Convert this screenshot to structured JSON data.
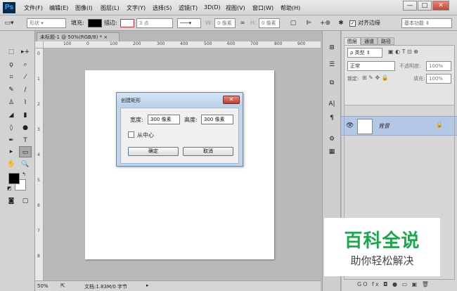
{
  "app": {
    "logo": "Ps"
  },
  "menu": [
    "文件(F)",
    "编辑(E)",
    "图像(I)",
    "图层(L)",
    "文字(Y)",
    "选择(S)",
    "滤镜(T)",
    "3D(D)",
    "视图(V)",
    "窗口(W)",
    "帮助(H)"
  ],
  "window_controls": {
    "minimize": "—",
    "maximize": "□",
    "close": "✕"
  },
  "options": {
    "shape_mode": "形状",
    "fill_label": "填充:",
    "stroke_label": "描边:",
    "stroke_size": "3 点",
    "w_label": "W:",
    "w_value": "0 像素",
    "h_label": "H:",
    "h_value": "0 像素",
    "align_edges_label": "对齐边缘",
    "workspace": "基本功能"
  },
  "document": {
    "tab_title": "未标题-1 @ 50%(RGB/8) *",
    "ruler_top": [
      "100",
      "0",
      "100",
      "200",
      "300",
      "400",
      "500",
      "600",
      "700",
      "800",
      "900"
    ],
    "ruler_left": [
      "0",
      "1",
      "2",
      "3",
      "4",
      "5",
      "6",
      "7",
      "8"
    ]
  },
  "status": {
    "zoom": "50%",
    "doc_info": "文档:1.83M/0 字节"
  },
  "dialog": {
    "title": "创建矩形",
    "width_label": "宽度:",
    "width_value": "300 像素",
    "height_label": "高度:",
    "height_value": "300 像素",
    "from_center_label": "从中心",
    "ok_label": "确定",
    "cancel_label": "取消"
  },
  "layers_panel": {
    "tabs": [
      "图层",
      "通道",
      "路径"
    ],
    "kind_filter": "ρ 类型",
    "blend_mode": "正常",
    "opacity_label": "不透明度:",
    "opacity_value": "100%",
    "lock_label": "锁定:",
    "fill_label": "填充:",
    "fill_value": "100%",
    "layer_name": "背景",
    "bottom_icons": [
      "GO",
      "fx",
      "◘",
      "●",
      "▭",
      "▣",
      "🗑"
    ]
  },
  "watermark": {
    "title": "百科全说",
    "subtitle": "助你轻松解决"
  },
  "colors": {
    "accent": "#31a8ff",
    "watermark_green": "#1aa94a",
    "layer_selected": "#b3c7e6"
  }
}
